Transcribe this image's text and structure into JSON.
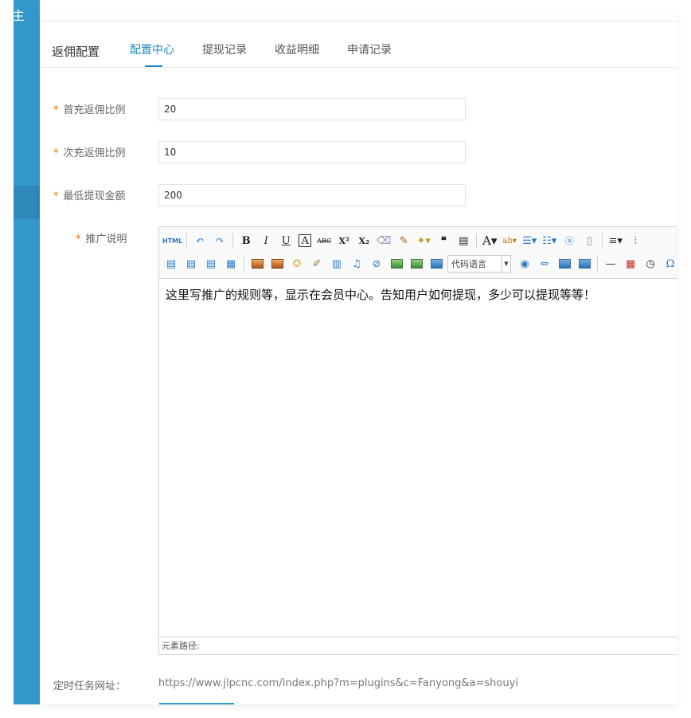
{
  "sidebar": {
    "glyph": "主"
  },
  "tabs": {
    "title": "返佣配置",
    "items": [
      {
        "label": "配置中心"
      },
      {
        "label": "提现记录"
      },
      {
        "label": "收益明细"
      },
      {
        "label": "申请记录"
      }
    ],
    "active_index": 0,
    "accent_color": "#1e88c7"
  },
  "form": {
    "required_mark": "*",
    "first_ratio": {
      "label": "首充返佣比例",
      "value": "20"
    },
    "second_ratio": {
      "label": "次充返佣比例",
      "value": "10"
    },
    "min_withdraw": {
      "label": "最低提现金额",
      "value": "200"
    },
    "promo_desc": {
      "label": "推广说明"
    }
  },
  "editor": {
    "toolbar": {
      "html_label": "HTML",
      "bold": "B",
      "italic": "I",
      "underline": "U",
      "font_border": "A",
      "strike": "ABC",
      "superscript": "X²",
      "subscript": "X₂",
      "code_language": "代码语言",
      "icons": [
        "html-icon",
        "undo-icon",
        "redo-icon",
        "bold-icon",
        "italic-icon",
        "underline-icon",
        "fontborder-icon",
        "strikethrough-icon",
        "superscript-icon",
        "subscript-icon",
        "eraser-icon",
        "formatmatch-icon",
        "autotypeset-icon",
        "blockquote-icon",
        "pasteplain-icon",
        "forecolor-icon",
        "backcolor-icon",
        "ordered-list-icon",
        "unordered-list-icon",
        "anchor-icon",
        "template-icon",
        "lineheight-icon",
        "paragraph-icon",
        "justify-left-icon",
        "justify-right-icon",
        "justify-center-icon",
        "justify-full-icon",
        "image-icon",
        "multi-image-icon",
        "emotion-icon",
        "scrawl-icon",
        "video-icon",
        "music-icon",
        "attachment-icon",
        "map-icon",
        "gmap-icon",
        "insertframe-icon",
        "insertcode-icon",
        "webapp-icon",
        "pagebreak-icon",
        "template2-icon",
        "background-icon",
        "horizontal-icon",
        "date-icon",
        "time-icon",
        "spechars-icon",
        "wordimage-icon"
      ]
    },
    "content": "这里写推广的规则等，显示在会员中心。告知用户如何提现，多少可以提现等等！",
    "path_label": "元素路径:"
  },
  "cron": {
    "label": "定时任务网址：",
    "url": "https://www.jlpcnc.com/index.php?m=plugins&c=Fanyong&a=shouyi"
  },
  "colors": {
    "sidebar": "#3399cc",
    "required": "#ff6a00"
  }
}
